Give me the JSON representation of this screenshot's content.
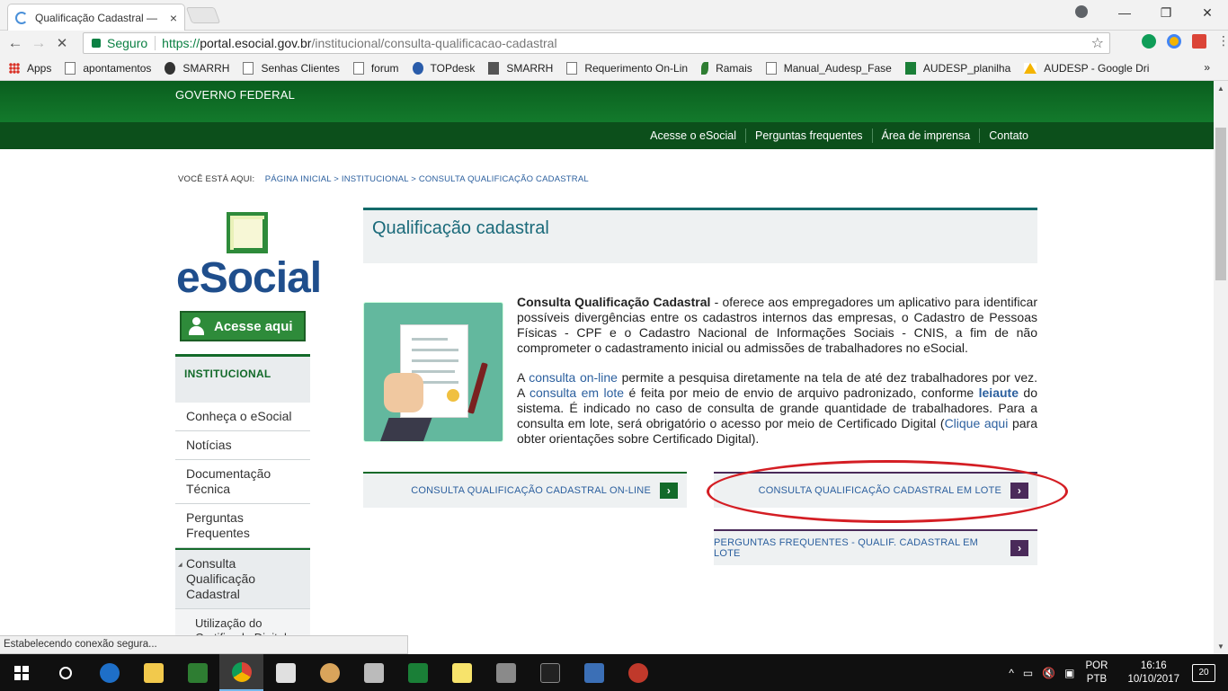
{
  "browser": {
    "tab_title": "Qualificação Cadastral — ",
    "tab_close": "×",
    "window_controls": [
      "—",
      "❐",
      "✕"
    ],
    "nav": {
      "back": "←",
      "forward": "→",
      "reload": "✕"
    },
    "secure_label": "Seguro",
    "url_scheme": "https://",
    "url_host": "portal.esocial.gov.br",
    "url_path": "/institucional/consulta-qualificacao-cadastral",
    "star": "☆",
    "bookmarks": [
      {
        "label": "Apps",
        "icon": "apps-icon",
        "cls": "apps"
      },
      {
        "label": "apontamentos",
        "icon": "page-icon",
        "cls": ""
      },
      {
        "label": "SMARRH",
        "icon": "alarm-icon",
        "cls": "round"
      },
      {
        "label": "Senhas Clientes",
        "icon": "page-icon",
        "cls": ""
      },
      {
        "label": "forum",
        "icon": "page-icon",
        "cls": ""
      },
      {
        "label": "TOPdesk",
        "icon": "topdesk-icon",
        "cls": "blue"
      },
      {
        "label": "SMARRH",
        "icon": "camera-icon",
        "cls": "camera"
      },
      {
        "label": "Requerimento On-Lin",
        "icon": "page-icon",
        "cls": ""
      },
      {
        "label": "Ramais",
        "icon": "leaf-icon",
        "cls": "leaf"
      },
      {
        "label": "Manual_Audesp_Fase",
        "icon": "page-icon",
        "cls": ""
      },
      {
        "label": "AUDESP_planilha",
        "icon": "sheets-icon",
        "cls": "green"
      },
      {
        "label": "AUDESP - Google Dri",
        "icon": "drive-icon",
        "cls": "drive"
      }
    ],
    "bookmarks_more": "»",
    "status_text": "Estabelecendo conexão segura..."
  },
  "site": {
    "gov_title": "GOVERNO FEDERAL",
    "top_nav": [
      "Acesse o eSocial",
      "Perguntas frequentes",
      "Área de imprensa",
      "Contato"
    ],
    "breadcrumb": {
      "prefix": "VOCÊ ESTÁ AQUI:",
      "trail": "PÁGINA INICIAL > INSTITUCIONAL > CONSULTA QUALIFICAÇÃO CADASTRAL"
    },
    "logo_text": "eSocial",
    "acesse_button": "Acesse aqui",
    "sidebar": {
      "heading": "INSTITUCIONAL",
      "items": [
        "Conheça o eSocial",
        "Notícias",
        "Documentação Técnica",
        "Perguntas Frequentes"
      ],
      "active_item": "Consulta Qualificação Cadastral",
      "sub_item": "Utilização do Certificado Digital"
    },
    "page_title": "Qualificação cadastral",
    "p1_bold": "Consulta Qualificação Cadastral",
    "p1_rest": " - oferece aos empregadores um aplicativo para identificar possíveis divergências entre os cadastros internos das empresas, o Cadastro de Pessoas Físicas - CPF e o Cadastro Nacional de Informações Sociais - CNIS, a fim de não comprometer o cadastramento inicial ou admissões de trabalhadores no eSocial.",
    "p2": {
      "t1": "A ",
      "l1": "consulta on-line",
      "t2": " permite a pesquisa diretamente na tela de até dez trabalhadores por vez. A ",
      "l2": "consulta em lote",
      "t3": " é feita por meio de envio de arquivo padronizado, conforme ",
      "l3": "leiaute",
      "t4": " do sistema. É indicado no caso de consulta de grande quantidade de trabalhadores. Para a consulta em lote, será obrigatório o acesso por meio de Certificado Digital (",
      "l4": "Clique aqui",
      "t5": " para obter orientações sobre Certificado Digital)."
    },
    "buttons": {
      "online": "CONSULTA QUALIFICAÇÃO CADASTRAL ON-LINE",
      "lote": "CONSULTA QUALIFICAÇÃO CADASTRAL EM LOTE",
      "faq_lote": "PERGUNTAS FREQUENTES - QUALIF. CADASTRAL EM LOTE",
      "arrow": "›"
    },
    "colors": {
      "green_dark": "#0c4f1b",
      "green_header": "#137a2c",
      "purple": "#4a2a5a",
      "link": "#2b5f9e",
      "annotation": "#d41e24"
    }
  },
  "taskbar": {
    "lang_line1": "POR",
    "lang_line2": "PTB",
    "time": "16:16",
    "date": "10/10/2017",
    "notifications": "20",
    "tray_glyphs": [
      "^",
      "▭",
      "🔇",
      "▣"
    ]
  }
}
